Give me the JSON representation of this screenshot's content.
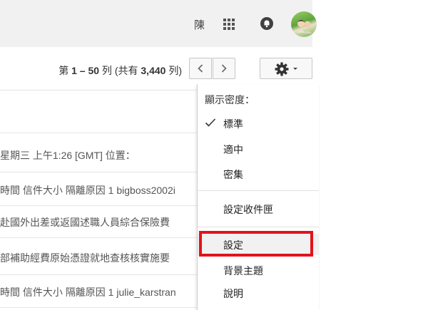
{
  "header": {
    "user_name": "陳",
    "apps_icon": "apps-grid-icon",
    "notifications_icon": "bell-icon"
  },
  "toolbar": {
    "pager_prefix": "第 ",
    "pager_range": "1 – 50",
    "pager_mid": " 列 (共有 ",
    "pager_total": "3,440",
    "pager_suffix": " 列)",
    "prev_icon": "chevron-left-icon",
    "next_icon": "chevron-right-icon",
    "settings_icon": "gear-icon"
  },
  "email_rows": [
    {
      "text": "星期三 上午1:26 [GMT] 位置："
    },
    {
      "text": "時間 信件大小 隔離原因 1 bigboss2002i"
    },
    {
      "text": "赴國外出差或返國述職人員綜合保險費"
    },
    {
      "text": "部補助經費原始憑證就地查核核實施要"
    },
    {
      "text": "時間 信件大小 隔離原因 1 julie_karstran"
    }
  ],
  "menu": {
    "density_heading": "顯示密度：",
    "density_options": [
      {
        "label": "標準",
        "checked": true
      },
      {
        "label": "適中",
        "checked": false
      },
      {
        "label": "密集",
        "checked": false
      }
    ],
    "configure_inbox": "設定收件匣",
    "settings": "設定",
    "themes": "背景主題",
    "help": "說明"
  },
  "colors": {
    "highlight": "#e3131b",
    "header_bg": "#f1f1f1"
  }
}
